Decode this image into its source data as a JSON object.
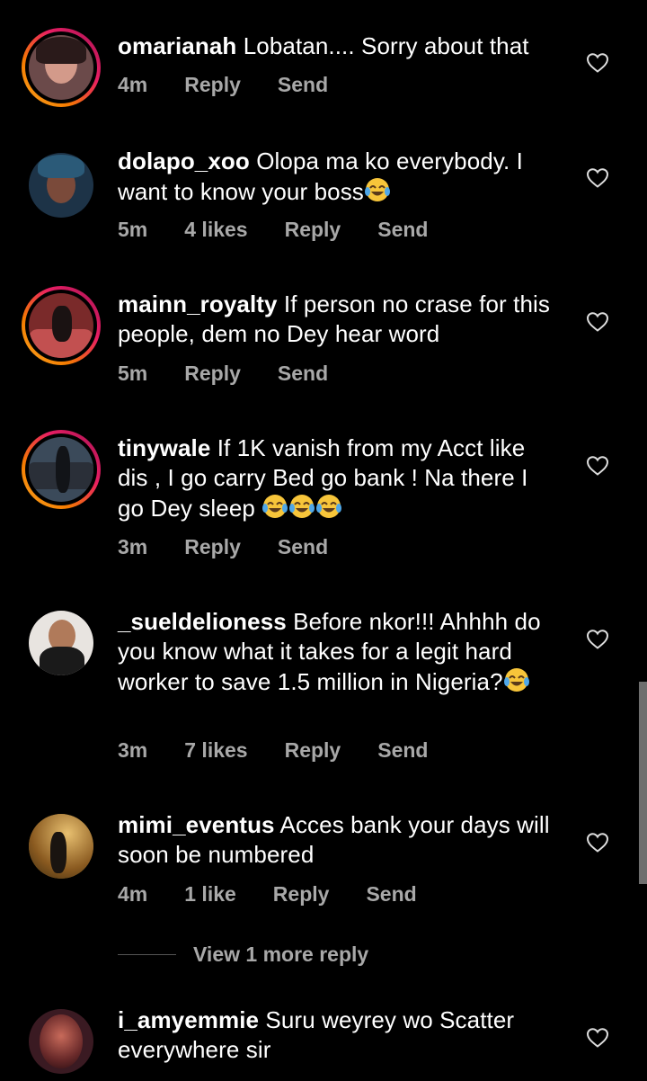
{
  "comments": [
    {
      "username": "omarianah",
      "text": " Lobatan.... Sorry about that",
      "time": "4m",
      "likes": "",
      "reply": "Reply",
      "send": "Send",
      "story_ring": true,
      "emoji_count": 0
    },
    {
      "username": "dolapo_xoo",
      "text": " Olopa ma ko everybody. I want to know your boss",
      "time": "5m",
      "likes": "4 likes",
      "reply": "Reply",
      "send": "Send",
      "story_ring": false,
      "emoji_count": 1
    },
    {
      "username": "mainn_royalty",
      "text": " If person no crase for this people, dem no Dey hear word",
      "time": "5m",
      "likes": "",
      "reply": "Reply",
      "send": "Send",
      "story_ring": true,
      "emoji_count": 0
    },
    {
      "username": "tinywale",
      "text": " If 1K vanish from my Acct like dis , I go carry Bed go bank ! Na there I go Dey sleep ",
      "time": "3m",
      "likes": "",
      "reply": "Reply",
      "send": "Send",
      "story_ring": true,
      "emoji_count": 3
    },
    {
      "username": "_sueldelioness",
      "text": " Before nkor!!! Ahhhh do you know what it takes for a legit hard worker to save 1.5 million in Nigeria?",
      "time": "3m",
      "likes": "7 likes",
      "reply": "Reply",
      "send": "Send",
      "story_ring": false,
      "emoji_count": 1
    },
    {
      "username": "mimi_eventus",
      "text": " Acces bank  your days will soon be numbered",
      "time": "4m",
      "likes": "1 like",
      "reply": "Reply",
      "send": "Send",
      "story_ring": false,
      "emoji_count": 0
    },
    {
      "username": "i_amyemmie",
      "text": " Suru weyrey wo Scatter everywhere sir",
      "time": "",
      "likes": "",
      "reply": "",
      "send": "",
      "story_ring": false,
      "emoji_count": 0
    }
  ],
  "view_more_reply": "View 1 more reply",
  "icons": {
    "like": "heart-outline-icon",
    "emoji": "face-with-tears-of-joy-emoji"
  },
  "colors": {
    "background": "#000000",
    "text": "#ffffff",
    "meta": "#a8a8a8",
    "story_ring_start": "#f9a825",
    "story_ring_end": "#c2185b"
  }
}
